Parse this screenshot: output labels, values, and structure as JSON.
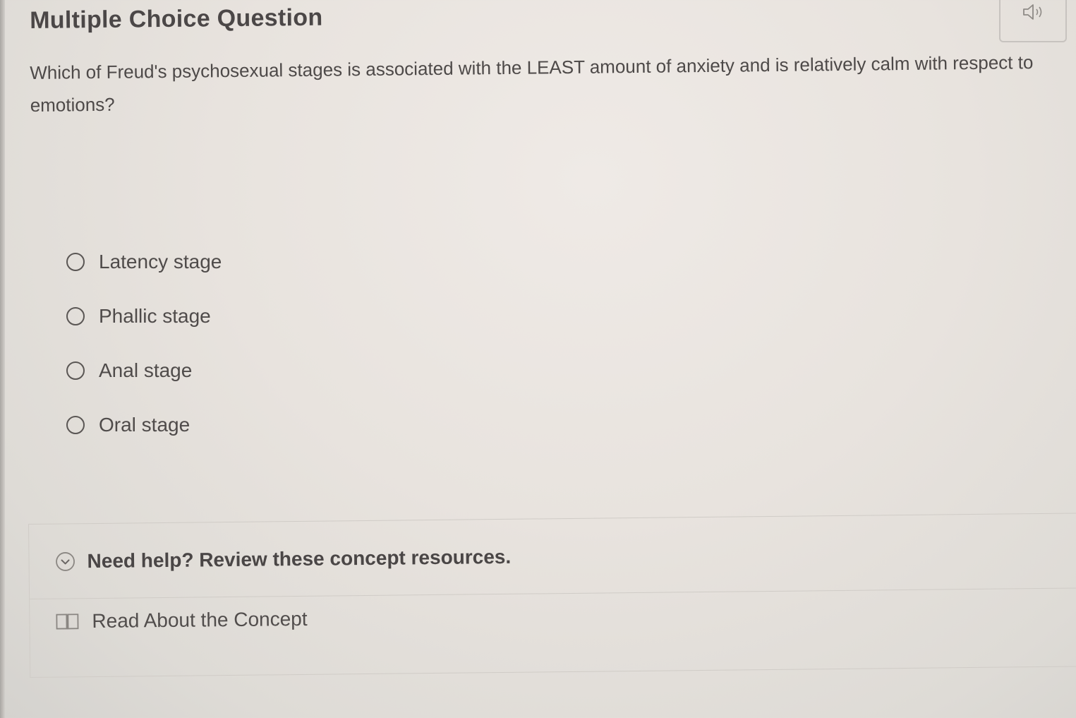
{
  "header": {
    "title": "Multiple Choice Question",
    "audio_icon": "speaker-icon"
  },
  "question": {
    "text": "Which of Freud's psychosexual stages is associated with the LEAST amount of anxiety and is relatively calm with respect to emotions?"
  },
  "options": [
    {
      "label": "Latency stage",
      "selected": false
    },
    {
      "label": "Phallic stage",
      "selected": false
    },
    {
      "label": "Anal stage",
      "selected": false
    },
    {
      "label": "Oral stage",
      "selected": false
    }
  ],
  "help": {
    "title": "Need help? Review these concept resources.",
    "toggle_icon": "chevron-down-circle-icon",
    "resources": [
      {
        "label": "Read About the Concept",
        "icon": "book-icon"
      }
    ]
  },
  "colors": {
    "text": "#4b4747",
    "border": "#d0ccc7",
    "background": "#e9e5e0"
  }
}
